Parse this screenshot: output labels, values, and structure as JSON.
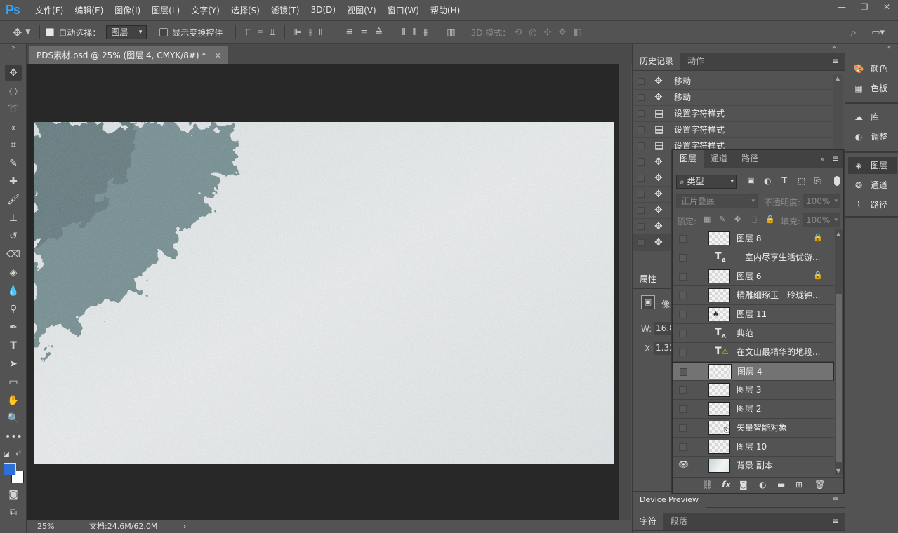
{
  "app": {
    "logo": "Ps"
  },
  "menu": [
    "文件(F)",
    "编辑(E)",
    "图像(I)",
    "图层(L)",
    "文字(Y)",
    "选择(S)",
    "滤镜(T)",
    "3D(D)",
    "视图(V)",
    "窗口(W)",
    "帮助(H)"
  ],
  "window_controls": {
    "minimize": "—",
    "restore": "❐",
    "close": "✕"
  },
  "options": {
    "auto_select_label": "自动选择：",
    "auto_select_target": "图层",
    "show_transform_label": "显示变换控件",
    "mode_3d_label": "3D 模式："
  },
  "document": {
    "tab_title": "PDS素材.psd @ 25% (图层 4, CMYK/8#) *",
    "tab_close": "×",
    "zoom": "25%",
    "doc_size": "文档:24.6M/62.0M",
    "status_arrow": "›"
  },
  "history": {
    "tabs": [
      "历史记录",
      "动作"
    ],
    "items": [
      {
        "icon": "move",
        "label": "移动"
      },
      {
        "icon": "move",
        "label": "移动"
      },
      {
        "icon": "doc",
        "label": "设置字符样式"
      },
      {
        "icon": "doc",
        "label": "设置字符样式"
      },
      {
        "icon": "doc",
        "label": "设置字符样式"
      },
      {
        "icon": "move",
        "label": ""
      },
      {
        "icon": "move",
        "label": ""
      },
      {
        "icon": "move",
        "label": ""
      },
      {
        "icon": "move",
        "label": ""
      },
      {
        "icon": "move",
        "label": ""
      },
      {
        "icon": "move",
        "label": ""
      }
    ]
  },
  "properties": {
    "tab": "属性",
    "kind_partial": "像素",
    "w_label": "W:",
    "w_value": "16.8",
    "x_label": "X:",
    "x_value": "1.32"
  },
  "layers": {
    "tabs": [
      "图层",
      "通道",
      "路径"
    ],
    "filter_kind": "类型",
    "blend_mode": "正片叠底",
    "opacity_label": "不透明度:",
    "opacity_value": "100%",
    "lock_label": "锁定:",
    "fill_label": "填充:",
    "fill_value": "100%",
    "items": [
      {
        "type": "pixel",
        "name": "图层 8",
        "locked": true,
        "visible": false,
        "selected": false
      },
      {
        "type": "text",
        "name": "一室内尽享生活优游...",
        "locked": false,
        "visible": false,
        "selected": false
      },
      {
        "type": "pixel",
        "name": "图层 6",
        "locked": true,
        "visible": false,
        "selected": false
      },
      {
        "type": "pixel",
        "name": "精雕细琢玉　玲珑钟...",
        "locked": false,
        "visible": false,
        "selected": false
      },
      {
        "type": "pixel",
        "name": "图层 11",
        "locked": false,
        "visible": false,
        "selected": false
      },
      {
        "type": "text",
        "name": "典范",
        "locked": false,
        "visible": false,
        "selected": false
      },
      {
        "type": "text-warn",
        "name": "在文山最精华的地段...",
        "locked": false,
        "visible": false,
        "selected": false
      },
      {
        "type": "pixel",
        "name": "图层 4",
        "locked": false,
        "visible": false,
        "selected": true
      },
      {
        "type": "pixel",
        "name": "图层 3",
        "locked": false,
        "visible": false,
        "selected": false
      },
      {
        "type": "pixel",
        "name": "图层 2",
        "locked": false,
        "visible": false,
        "selected": false
      },
      {
        "type": "smart",
        "name": "矢量智能对象",
        "locked": false,
        "visible": false,
        "selected": false
      },
      {
        "type": "pixel",
        "name": "图层 10",
        "locked": false,
        "visible": false,
        "selected": false
      },
      {
        "type": "image",
        "name": "背景 副本",
        "locked": false,
        "visible": true,
        "selected": false
      }
    ],
    "footer_fx": "fx"
  },
  "bottom_panels": {
    "device_preview": "Device Preview",
    "char_tabs": [
      "字符",
      "段落"
    ]
  },
  "dock": {
    "group1": [
      {
        "icon": "palette-icon",
        "label": "颜色"
      },
      {
        "icon": "swatches-icon",
        "label": "色板"
      }
    ],
    "group2": [
      {
        "icon": "library-icon",
        "label": "库"
      },
      {
        "icon": "adjust-icon",
        "label": "调整"
      }
    ],
    "group3": [
      {
        "icon": "layers-icon",
        "label": "图层"
      },
      {
        "icon": "channels-icon",
        "label": "通道"
      },
      {
        "icon": "paths-icon",
        "label": "路径"
      }
    ]
  },
  "colors": {
    "foreground": "#2d6fd6",
    "background": "#ffffff",
    "accent": "#31a8ff"
  }
}
